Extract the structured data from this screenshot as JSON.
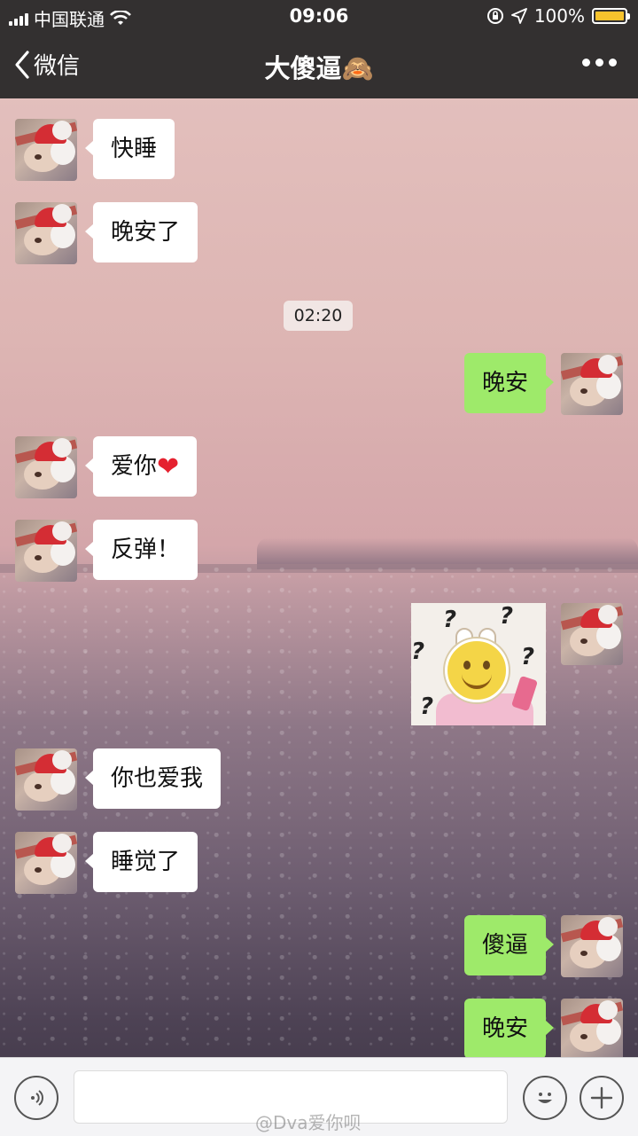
{
  "status_bar": {
    "carrier": "中国联通",
    "time": "09:06",
    "battery_percent": "100%",
    "battery_level": 1.0,
    "battery_color": "#f7c32d"
  },
  "nav": {
    "back_label": "微信",
    "title": "大傻逼🙈"
  },
  "timestamp": "02:20",
  "messages": [
    {
      "side": "left",
      "text": "快睡"
    },
    {
      "side": "left",
      "text": "晚安了"
    },
    {
      "side": "right",
      "text": "晚安"
    },
    {
      "side": "left",
      "text": "爱你",
      "emoji": "❤"
    },
    {
      "side": "left",
      "text": "反弹！"
    },
    {
      "side": "right",
      "type": "sticker",
      "icon": "smiley-bunny-question-sticker"
    },
    {
      "side": "left",
      "text": "你也爱我"
    },
    {
      "side": "left",
      "text": "睡觉了"
    },
    {
      "side": "right",
      "text": "傻逼"
    },
    {
      "side": "right",
      "text": "晚安"
    }
  ],
  "input_bar": {
    "text_value": "",
    "voice_icon": "voice-icon",
    "emoji_icon": "emoji-icon",
    "plus_icon": "plus-icon"
  },
  "watermark": "@Dva爱你呗",
  "colors": {
    "header_bg": "#333030",
    "own_bubble": "#9eea6a",
    "other_bubble": "#ffffff"
  }
}
